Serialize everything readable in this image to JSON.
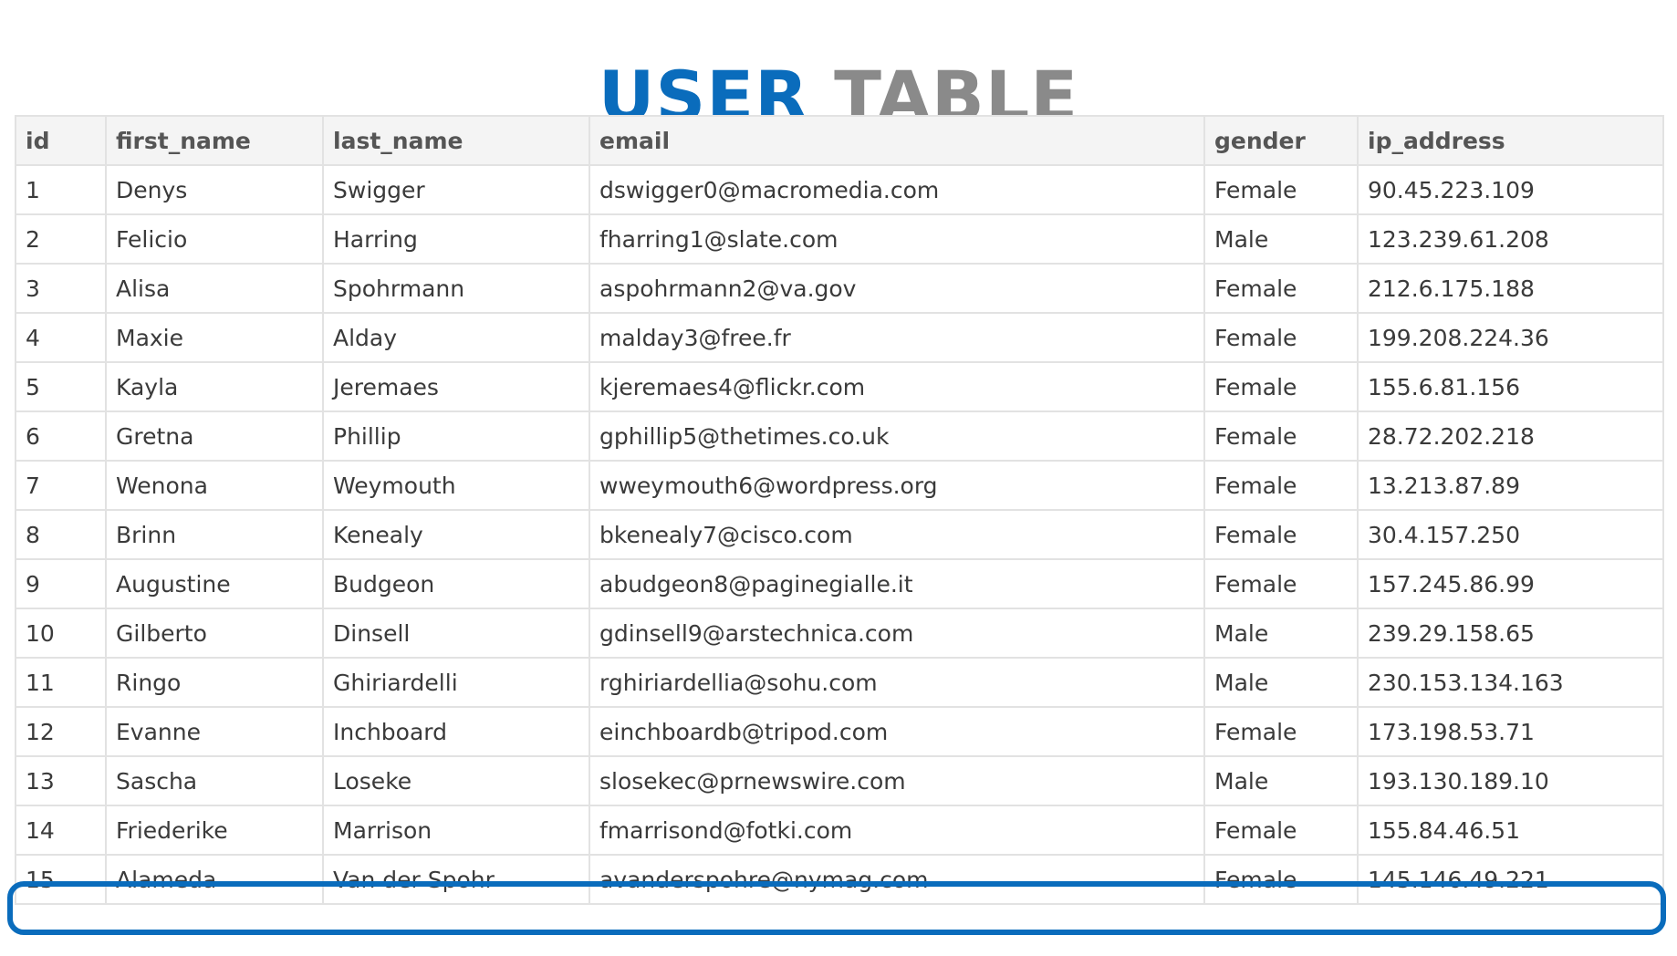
{
  "title": {
    "first": "USER",
    "second": "TABLE"
  },
  "colors": {
    "accent": "#0a6cbc",
    "title_secondary": "#8a8a8a",
    "header_bg": "#f4f4f4",
    "border": "#e2e2e2"
  },
  "table": {
    "headers": {
      "id": "id",
      "first_name": "first_name",
      "last_name": "last_name",
      "email": "email",
      "gender": "gender",
      "ip_address": "ip_address"
    },
    "rows": [
      {
        "id": "1",
        "first_name": "Denys",
        "last_name": "Swigger",
        "email": "dswigger0@macromedia.com",
        "gender": "Female",
        "ip_address": "90.45.223.109"
      },
      {
        "id": "2",
        "first_name": "Felicio",
        "last_name": "Harring",
        "email": "fharring1@slate.com",
        "gender": "Male",
        "ip_address": "123.239.61.208"
      },
      {
        "id": "3",
        "first_name": "Alisa",
        "last_name": "Spohrmann",
        "email": "aspohrmann2@va.gov",
        "gender": "Female",
        "ip_address": "212.6.175.188"
      },
      {
        "id": "4",
        "first_name": "Maxie",
        "last_name": "Alday",
        "email": "malday3@free.fr",
        "gender": "Female",
        "ip_address": "199.208.224.36"
      },
      {
        "id": "5",
        "first_name": "Kayla",
        "last_name": "Jeremaes",
        "email": "kjeremaes4@flickr.com",
        "gender": "Female",
        "ip_address": "155.6.81.156"
      },
      {
        "id": "6",
        "first_name": "Gretna",
        "last_name": "Phillip",
        "email": "gphillip5@thetimes.co.uk",
        "gender": "Female",
        "ip_address": "28.72.202.218"
      },
      {
        "id": "7",
        "first_name": "Wenona",
        "last_name": "Weymouth",
        "email": "wweymouth6@wordpress.org",
        "gender": "Female",
        "ip_address": "13.213.87.89"
      },
      {
        "id": "8",
        "first_name": "Brinn",
        "last_name": "Kenealy",
        "email": "bkenealy7@cisco.com",
        "gender": "Female",
        "ip_address": "30.4.157.250"
      },
      {
        "id": "9",
        "first_name": "Augustine",
        "last_name": "Budgeon",
        "email": "abudgeon8@paginegialle.it",
        "gender": "Female",
        "ip_address": "157.245.86.99"
      },
      {
        "id": "10",
        "first_name": "Gilberto",
        "last_name": "Dinsell",
        "email": "gdinsell9@arstechnica.com",
        "gender": "Male",
        "ip_address": "239.29.158.65"
      },
      {
        "id": "11",
        "first_name": "Ringo",
        "last_name": "Ghiriardelli",
        "email": "rghiriardellia@sohu.com",
        "gender": "Male",
        "ip_address": "230.153.134.163"
      },
      {
        "id": "12",
        "first_name": "Evanne",
        "last_name": "Inchboard",
        "email": "einchboardb@tripod.com",
        "gender": "Female",
        "ip_address": "173.198.53.71"
      },
      {
        "id": "13",
        "first_name": "Sascha",
        "last_name": "Loseke",
        "email": "slosekec@prnewswire.com",
        "gender": "Male",
        "ip_address": "193.130.189.10"
      },
      {
        "id": "14",
        "first_name": "Friederike",
        "last_name": "Marrison",
        "email": "fmarrisond@fotki.com",
        "gender": "Female",
        "ip_address": "155.84.46.51"
      },
      {
        "id": "15",
        "first_name": "Alameda",
        "last_name": "Van der Spohr",
        "email": "avanderspohre@nymag.com",
        "gender": "Female",
        "ip_address": "145.146.49.221"
      }
    ],
    "highlighted_row_id": "15"
  }
}
